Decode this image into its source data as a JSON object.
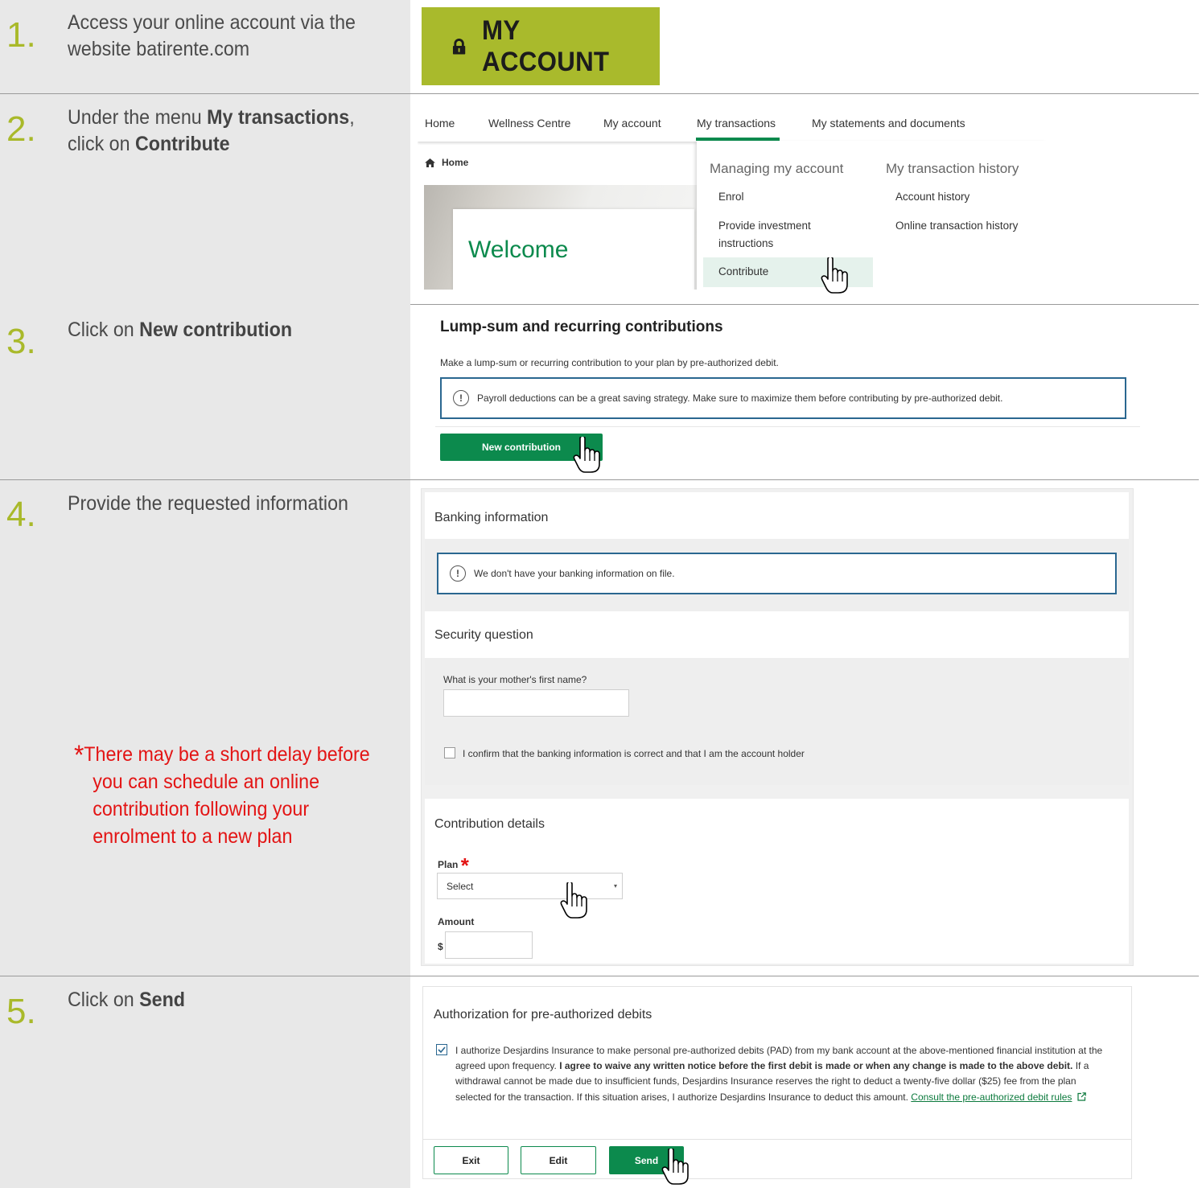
{
  "steps": [
    {
      "number": "1",
      "text_a": "Access your online account via the",
      "text_b": "website batirente.com"
    },
    {
      "number": "2",
      "text_a": "Under the menu ",
      "text_a_bold": "My transactions",
      "text_a_end": ",",
      "text_b": "click on ",
      "text_b_bold": "Contribute"
    },
    {
      "number": "3",
      "text_a": "Click on ",
      "text_a_bold": "New contribution"
    },
    {
      "number": "4",
      "text_a": "Provide the requested information"
    },
    {
      "number": "5",
      "text_a": "Click on ",
      "text_a_bold": "Send"
    }
  ],
  "note": {
    "asterisk": "*",
    "line1": "There may be a short delay before",
    "line2": "you can schedule an online",
    "line3": "contribution following your",
    "line4": "enrolment to a new plan"
  },
  "step1": {
    "button_label": "MY ACCOUNT",
    "icon": "lock-icon"
  },
  "step2": {
    "nav": [
      "Home",
      "Wellness Centre",
      "My account",
      "My transactions",
      "My statements and documents"
    ],
    "breadcrumb": "Home",
    "welcome": "Welcome",
    "dropdown": {
      "col1_heading": "Managing my account",
      "col1_items": [
        "Enrol",
        "Provide investment",
        "instructions",
        "Contribute"
      ],
      "col2_heading": "My transaction history",
      "col2_items": [
        "Account history",
        "Online transaction history"
      ]
    }
  },
  "step3": {
    "title": "Lump-sum and recurring contributions",
    "description": "Make a lump-sum or recurring contribution to your plan by pre-authorized debit.",
    "info_icon": "!",
    "info": "Payroll deductions can be a great saving strategy. Make sure to maximize them before contributing by pre-authorized debit.",
    "button": "New contribution"
  },
  "step4": {
    "banking_title": "Banking information",
    "banking_info": "We don't have your banking information on file.",
    "security_title": "Security question",
    "security_question": "What is your mother's first name?",
    "confirm_label": "I confirm that the banking information is correct and that I am the account holder",
    "contribution_title": "Contribution details",
    "plan_label": "Plan",
    "required_marker": "*",
    "plan_select": "Select",
    "select_caret": "▾",
    "amount_label": "Amount",
    "currency": "$"
  },
  "step5": {
    "title": "Authorization for pre-authorized debits",
    "auth_text_1": "I authorize Desjardins Insurance to make personal pre-authorized debits (PAD) from my bank account at the above-mentioned financial institution at the agreed upon frequency. ",
    "auth_text_bold": "I agree to waive any written notice before the first debit is made or when any change is made to the above debit.",
    "auth_text_2": " If a withdrawal cannot be made due to insufficient funds, Desjardins Insurance reserves the right to deduct a twenty-five dollar ($25) fee from the plan selected for the transaction. If this situation arises, I authorize Desjardins Insurance to deduct this amount. ",
    "link": "Consult the pre-authorized debit rules",
    "checkbox_checked": true,
    "buttons": {
      "exit": "Exit",
      "edit": "Edit",
      "send": "Send"
    }
  },
  "colors": {
    "accent_lime": "#a9ba2c",
    "brand_green": "#0c8a4d",
    "note_red": "#e31414",
    "info_border": "#2a6790",
    "left_bg": "#e8e8e8"
  }
}
